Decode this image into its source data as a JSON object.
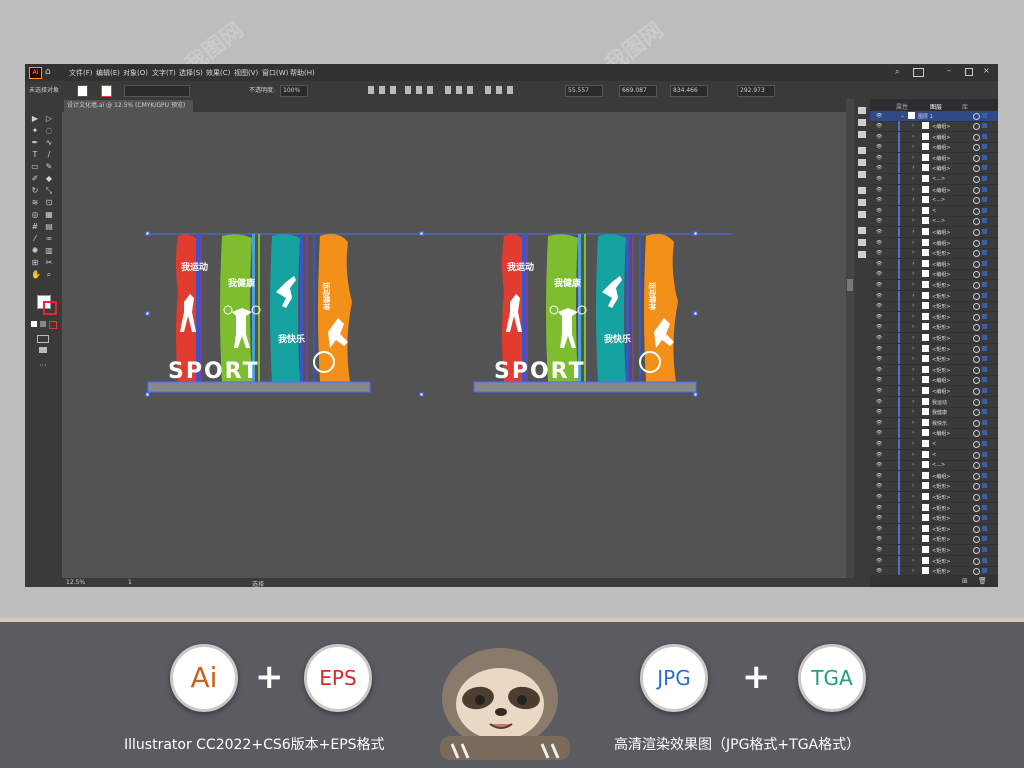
{
  "menubar": {
    "app_icon": "Ai",
    "items": [
      "文件(F)",
      "编辑(E)",
      "对象(O)",
      "文字(T)",
      "选择(S)",
      "效果(C)",
      "视图(V)",
      "窗口(W)",
      "帮助(H)"
    ]
  },
  "control_bar": {
    "left_label": "未选择对象",
    "opacity_label": "不透明度:",
    "opacity_value": "100%",
    "x_value": "55.557",
    "y_value": "669.087",
    "w_value": "834.466",
    "h_value": "292.973"
  },
  "document_tab": {
    "title": "设计文化墙.ai @ 12.5% (CMYK/GPU 预览)"
  },
  "status_bar": {
    "zoom": "12.5%",
    "page": "1",
    "tool": "选择"
  },
  "layers_panel": {
    "tabs": [
      "属性",
      "图层",
      "库"
    ],
    "top_layer": "图层 1",
    "rows": [
      "<编组>",
      "<编组>",
      "<编组>",
      "<编组>",
      "<编组>",
      "<...>",
      "<编组>",
      "<...>",
      "<",
      "<...>",
      "<编组>",
      "<编组>",
      "<矩形>",
      "<编组>",
      "<编组>",
      "<矩形>",
      "<矩形>",
      "<矩形>",
      "<矩形>",
      "<矩形>",
      "<矩形>",
      "<矩形>",
      "<矩形>",
      "<矩形>",
      "<编组>",
      "<编组>",
      "我运动",
      "我健康",
      "我快乐",
      "<编组>",
      "<",
      "<",
      "<...>",
      "<编组>",
      "<矩形>",
      "<矩形>",
      "<矩形>",
      "<矩形>",
      "<矩形>",
      "<矩形>",
      "<矩形>",
      "<矩形>",
      "<矩形>"
    ]
  },
  "artwork": {
    "panel_texts": [
      "我运动",
      "我健康",
      "我快乐",
      "运动精神"
    ],
    "sport_word": "SPORT",
    "colors": {
      "red": "#e23b2f",
      "green": "#7dbd2f",
      "teal": "#14a3a1",
      "orange": "#f39019",
      "blue": "#3a57c4",
      "purple": "#7a3ea8"
    }
  },
  "bottom": {
    "badges": [
      {
        "label": "Ai",
        "color": "#c8621e"
      },
      {
        "label": "EPS",
        "color": "#d22a2a"
      },
      {
        "label": "JPG",
        "color": "#2a6fcf"
      },
      {
        "label": "TGA",
        "color": "#1f9e7c"
      }
    ],
    "plus": "+",
    "caption_left": "Illustrator CC2022+CS6版本+EPS格式",
    "caption_right": "高清渲染效果图（JPG格式+TGA格式）"
  },
  "watermark": "我图网"
}
